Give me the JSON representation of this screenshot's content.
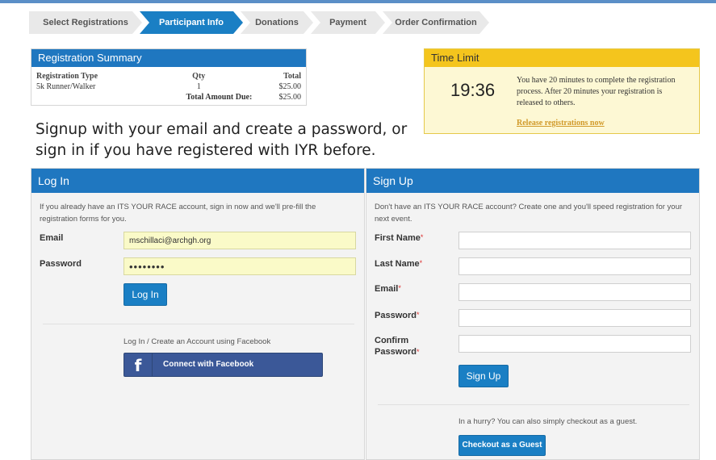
{
  "steps": [
    {
      "label": "Select Registrations",
      "active": false
    },
    {
      "label": "Participant Info",
      "active": true
    },
    {
      "label": "Donations",
      "active": false
    },
    {
      "label": "Payment",
      "active": false
    },
    {
      "label": "Order Confirmation",
      "active": false
    }
  ],
  "summary": {
    "title": "Registration Summary",
    "col_type": "Registration Type",
    "col_qty": "Qty",
    "col_total": "Total",
    "row_type": "5k Runner/Walker",
    "row_qty": "1",
    "row_total": "$25.00",
    "total_label": "Total Amount Due:",
    "total_value": "$25.00"
  },
  "time_limit": {
    "title": "Time Limit",
    "timer": "19:36",
    "message": "You have 20 minutes to complete the registration process. After 20 minutes your registration is released to others.",
    "release_link": "Release registrations now"
  },
  "heading": "Signup with your email and create a password, or sign in if you have registered with IYR before.",
  "login": {
    "title": "Log In",
    "intro": "If you already have an ITS YOUR RACE account, sign in now and we'll pre-fill the registration forms for you.",
    "email_label": "Email",
    "email_value": "mschillaci@archgh.org",
    "password_label": "Password",
    "password_value": "••••••••",
    "button": "Log In",
    "facebook_text": "Log In / Create an Account using Facebook",
    "facebook_icon": "f",
    "facebook_button": "Connect with Facebook"
  },
  "signup": {
    "title": "Sign Up",
    "intro": "Don't have an ITS YOUR RACE account? Create one and you'll speed registration for your next event.",
    "first_name_label": "First Name",
    "last_name_label": "Last Name",
    "email_label": "Email",
    "password_label": "Password",
    "confirm_label": "Confirm Password",
    "required_mark": "*",
    "button": "Sign Up",
    "guest_text": "In a hurry? You can also simply checkout as a guest.",
    "guest_button": "Checkout as a Guest"
  },
  "colors": {
    "accent": "#1a7fc4",
    "time_limit_header": "#f4c51d",
    "facebook": "#3b5898"
  }
}
